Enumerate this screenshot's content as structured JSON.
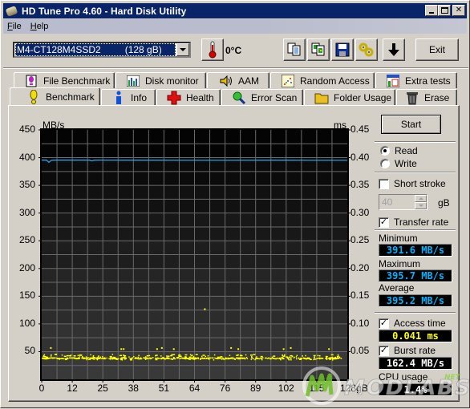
{
  "window": {
    "title": "HD Tune Pro 4.60 - Hard Disk Utility",
    "controls": [
      "minimize",
      "maximize",
      "close"
    ]
  },
  "menu": [
    {
      "label": "File",
      "accel": "F",
      "rest": "ile"
    },
    {
      "label": "Help",
      "accel": "H",
      "rest": "elp"
    }
  ],
  "toolbar": {
    "drive": {
      "name": "M4-CT128M4SSD2",
      "capacity": "(128 gB)"
    },
    "temperature": "0°C",
    "buttons": [
      {
        "name": "copy-text-icon"
      },
      {
        "name": "copy-screenshot-icon"
      },
      {
        "name": "save-icon"
      },
      {
        "name": "options-icon"
      },
      {
        "name": "download-arrow-icon"
      }
    ],
    "exit_label": "Exit"
  },
  "tabs": {
    "row_back": [
      {
        "label": "File Benchmark",
        "icon": "file-benchmark-icon"
      },
      {
        "label": "Disk monitor",
        "icon": "disk-monitor-icon"
      },
      {
        "label": "AAM",
        "icon": "speaker-icon"
      },
      {
        "label": "Random Access",
        "icon": "random-access-icon"
      },
      {
        "label": "Extra tests",
        "icon": "extra-tests-icon"
      }
    ],
    "row_front": [
      {
        "label": "Benchmark",
        "icon": "exclamation-icon",
        "active": true
      },
      {
        "label": "Info",
        "icon": "info-icon"
      },
      {
        "label": "Health",
        "icon": "health-cross-icon"
      },
      {
        "label": "Error Scan",
        "icon": "magnifier-icon"
      },
      {
        "label": "Folder Usage",
        "icon": "folder-icon"
      },
      {
        "label": "Erase",
        "icon": "trash-icon"
      }
    ]
  },
  "controls": {
    "start_label": "Start",
    "mode_options": [
      {
        "label": "Read",
        "selected": true
      },
      {
        "label": "Write",
        "selected": false
      }
    ],
    "short_stroke": {
      "label": "Short stroke",
      "checked": false,
      "value": "40",
      "unit": "gB"
    },
    "transfer_rate": {
      "label": "Transfer rate",
      "checked": true
    },
    "minimum": {
      "label": "Minimum",
      "value": "391.6 MB/s"
    },
    "maximum": {
      "label": "Maximum",
      "value": "395.7 MB/s"
    },
    "average": {
      "label": "Average",
      "value": "395.2 MB/s"
    },
    "access_time": {
      "label": "Access time",
      "checked": true,
      "value": "0.041 ms"
    },
    "burst_rate": {
      "label": "Burst rate",
      "checked": true,
      "value": "162.4 MB/s"
    },
    "cpu_usage": {
      "label": "CPU usage",
      "value": "1.4%"
    }
  },
  "colors": {
    "transfer_line": "#1ea0e6",
    "access_points": "#ffff00",
    "value_cyan": "#00b4ff",
    "value_yellow": "#ffff00",
    "value_white": "#ffffff",
    "title_bar": "#0a246a"
  },
  "watermark": {
    "text": "MODLABS",
    "suffix": "NET"
  },
  "chart_data": {
    "type": "line",
    "title": "",
    "xlabel": "",
    "ylabel_left": "MB/s",
    "ylabel_right": "ms",
    "xlim": [
      0,
      128
    ],
    "ylim_left": [
      0,
      450
    ],
    "ylim_right": [
      0,
      0.45
    ],
    "grid": true,
    "x_ticks": [
      "0",
      "12",
      "25",
      "38",
      "51",
      "64",
      "76",
      "89",
      "102",
      "115",
      "128gB"
    ],
    "x_tick_values": [
      0,
      12.8,
      25.6,
      38.4,
      51.2,
      64,
      76.8,
      89.6,
      102.4,
      115.2,
      128
    ],
    "y_ticks_left": [
      "450",
      "400",
      "350",
      "300",
      "250",
      "200",
      "150",
      "100",
      "50"
    ],
    "y_ticks_right": [
      "0.45",
      "0.40",
      "0.35",
      "0.30",
      "0.25",
      "0.20",
      "0.15",
      "0.10",
      "0.05"
    ],
    "series": [
      {
        "name": "Transfer rate (MB/s)",
        "axis": "left",
        "kind": "line",
        "x": [
          0,
          2,
          3,
          4,
          6,
          20,
          21,
          22,
          40,
          60,
          80,
          100,
          120,
          128
        ],
        "y": [
          395.5,
          395.5,
          391.6,
          395.0,
          395.4,
          395.4,
          394.2,
          395.4,
          395.3,
          395.2,
          395.2,
          395.3,
          395.2,
          395.2
        ]
      },
      {
        "name": "Access time (ms)",
        "axis": "right",
        "kind": "scatter",
        "outliers": [
          {
            "x": 3.5,
            "y": 0.058
          },
          {
            "x": 33,
            "y": 0.056
          },
          {
            "x": 34,
            "y": 0.056
          },
          {
            "x": 48,
            "y": 0.056
          },
          {
            "x": 50,
            "y": 0.058
          },
          {
            "x": 55,
            "y": 0.056
          },
          {
            "x": 79,
            "y": 0.058
          },
          {
            "x": 82,
            "y": 0.056
          },
          {
            "x": 68,
            "y": 0.128
          },
          {
            "x": 101,
            "y": 0.056
          },
          {
            "x": 104,
            "y": 0.058
          },
          {
            "x": 120,
            "y": 0.056
          }
        ],
        "band": {
          "x_range": [
            0,
            128
          ],
          "y_range": [
            0.036,
            0.046
          ],
          "typical": 0.041
        }
      }
    ]
  }
}
